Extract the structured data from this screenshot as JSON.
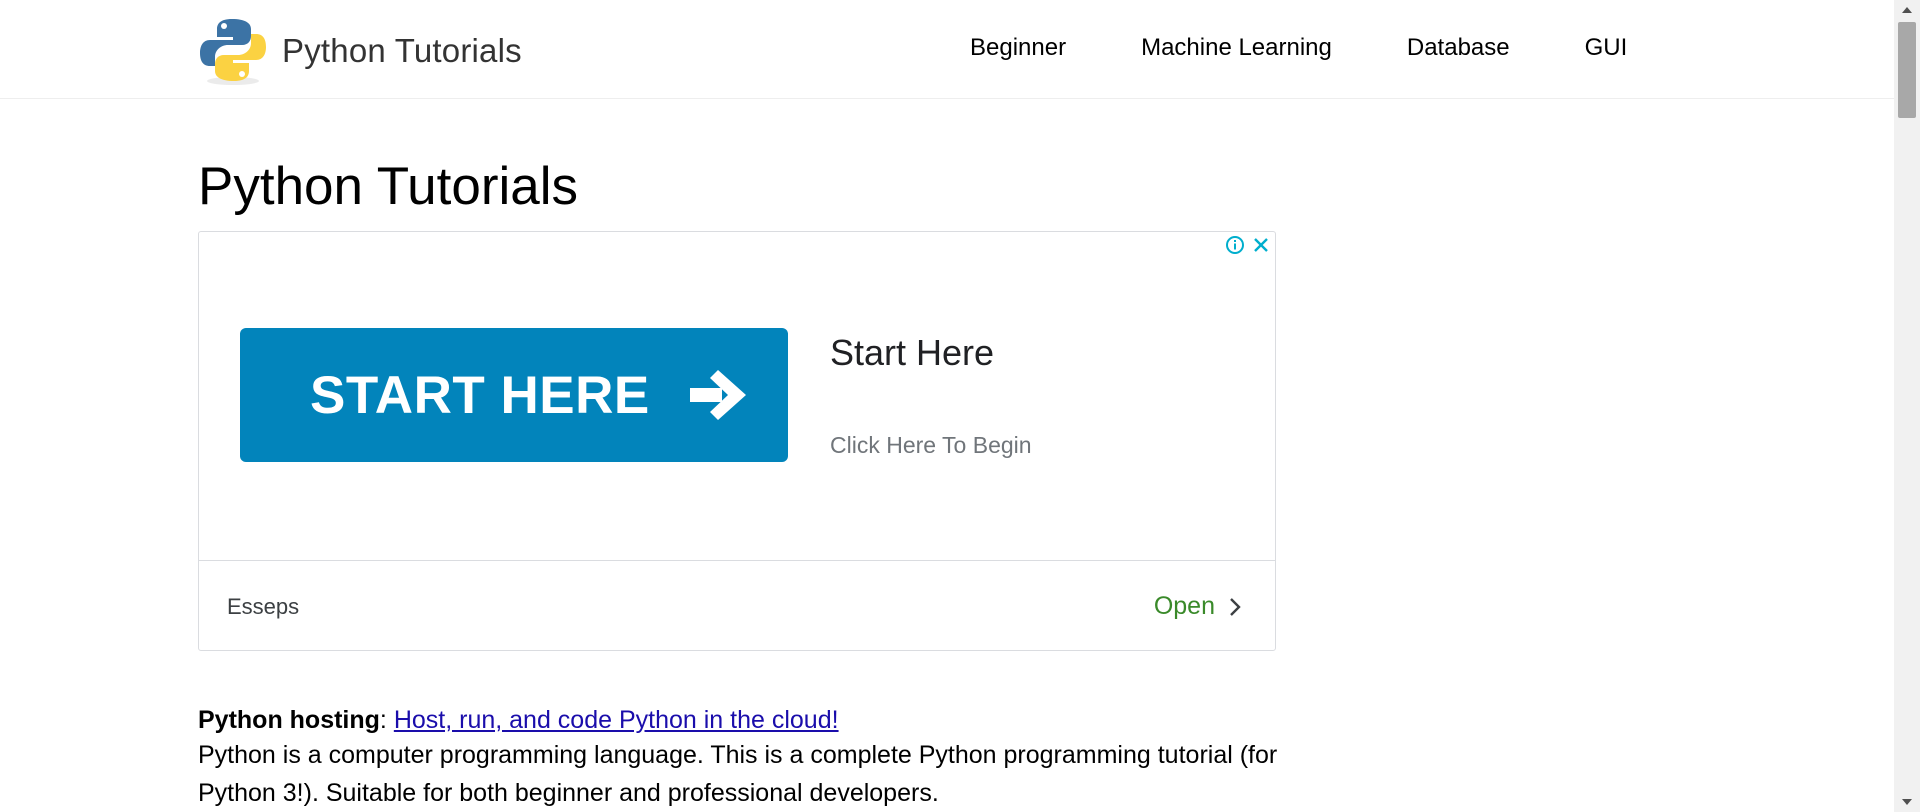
{
  "header": {
    "logo_text": "Python Tutorials",
    "nav": [
      "Beginner",
      "Machine Learning",
      "Database",
      "GUI"
    ]
  },
  "main": {
    "title": "Python Tutorials",
    "ad": {
      "banner_text": "START HERE",
      "headline": "Start Here",
      "subtext": "Click Here To Begin",
      "advertiser": "Esseps",
      "cta": "Open",
      "banner_color": "#0284bb",
      "cta_color": "#3a8a2a",
      "icons": [
        "info-icon",
        "close-icon",
        "arrow-right-icon",
        "chevron-right-icon"
      ]
    },
    "hosting": {
      "label": "Python hosting",
      "separator": ":",
      "link_text": "Host, run, and code Python in the cloud!"
    },
    "intro": "Python is a computer programming language. This is a complete Python programming tutorial (for Python 3!). Suitable for both beginner and professional developers."
  },
  "colors": {
    "link": "#1a0dab",
    "text": "#000000",
    "logo_text": "#333333"
  }
}
